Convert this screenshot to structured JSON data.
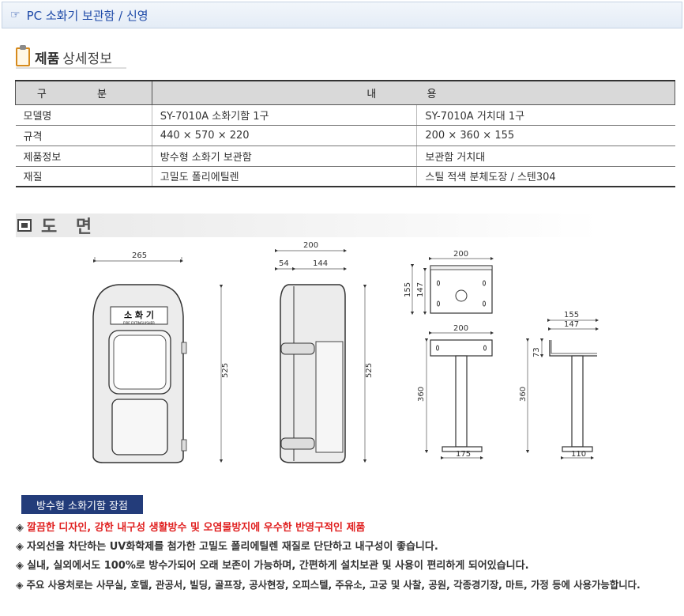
{
  "header": {
    "title": "PC 소화기 보관함 / 신영"
  },
  "section": {
    "title_bold": "제품",
    "title_rest": "상세정보"
  },
  "table": {
    "head": [
      "구 분",
      "내 용"
    ],
    "rows": [
      {
        "label": "모델명",
        "c1": "SY-7010A 소화기함 1구",
        "c2": "SY-7010A 거치대 1구"
      },
      {
        "label": "규격",
        "c1": "440 × 570 × 220",
        "c2": "200 × 360 × 155"
      },
      {
        "label": "제품정보",
        "c1": "방수형 소화기 보관함",
        "c2": "보관함 거치대"
      },
      {
        "label": "재질",
        "c1": "고밀도 폴리에틸렌",
        "c2": "스틸 적색 분체도장 / 스텐304"
      }
    ]
  },
  "drawing": {
    "title": "도 면",
    "box_label": "소 화 기",
    "box_sub": "FIRE EXTINGUISHER",
    "dims": {
      "front_w": "265",
      "front_h": "525",
      "side_w": "200",
      "side_a": "54",
      "side_b": "144",
      "side_h": "525",
      "plate_w": "200",
      "plate_h1": "155",
      "plate_h2": "147",
      "stand_w": "200",
      "stand_h": "360",
      "stand_base": "175",
      "side_stand_top": "155",
      "side_stand_top2": "147",
      "side_stand_a": "73",
      "side_stand_h": "360",
      "side_stand_base": "110"
    }
  },
  "features": {
    "badge": "방수형 소화기함 장점",
    "items": [
      "깔끔한 디자인, 강한 내구성 생활방수 및 오염물방지에 우수한 반영구적인 제품",
      "자외선을 차단하는 UV화학제를 첨가한 고밀도 폴리에틸렌 재질로 단단하고 내구성이 좋습니다.",
      "실내, 실외에서도 100%로 방수가되어 오래 보존이 가능하며, 간편하게 설치보관 및 사용이 편리하게 되어있습니다.",
      "주요 사용처로는 사무실, 호텔, 관공서, 빌딩, 골프장, 공사현장, 오피스텔, 주유소, 고궁 및 사찰, 공원, 각종경기장, 마트, 가정 등에 사용가능합니다."
    ],
    "diamond": "◈"
  }
}
